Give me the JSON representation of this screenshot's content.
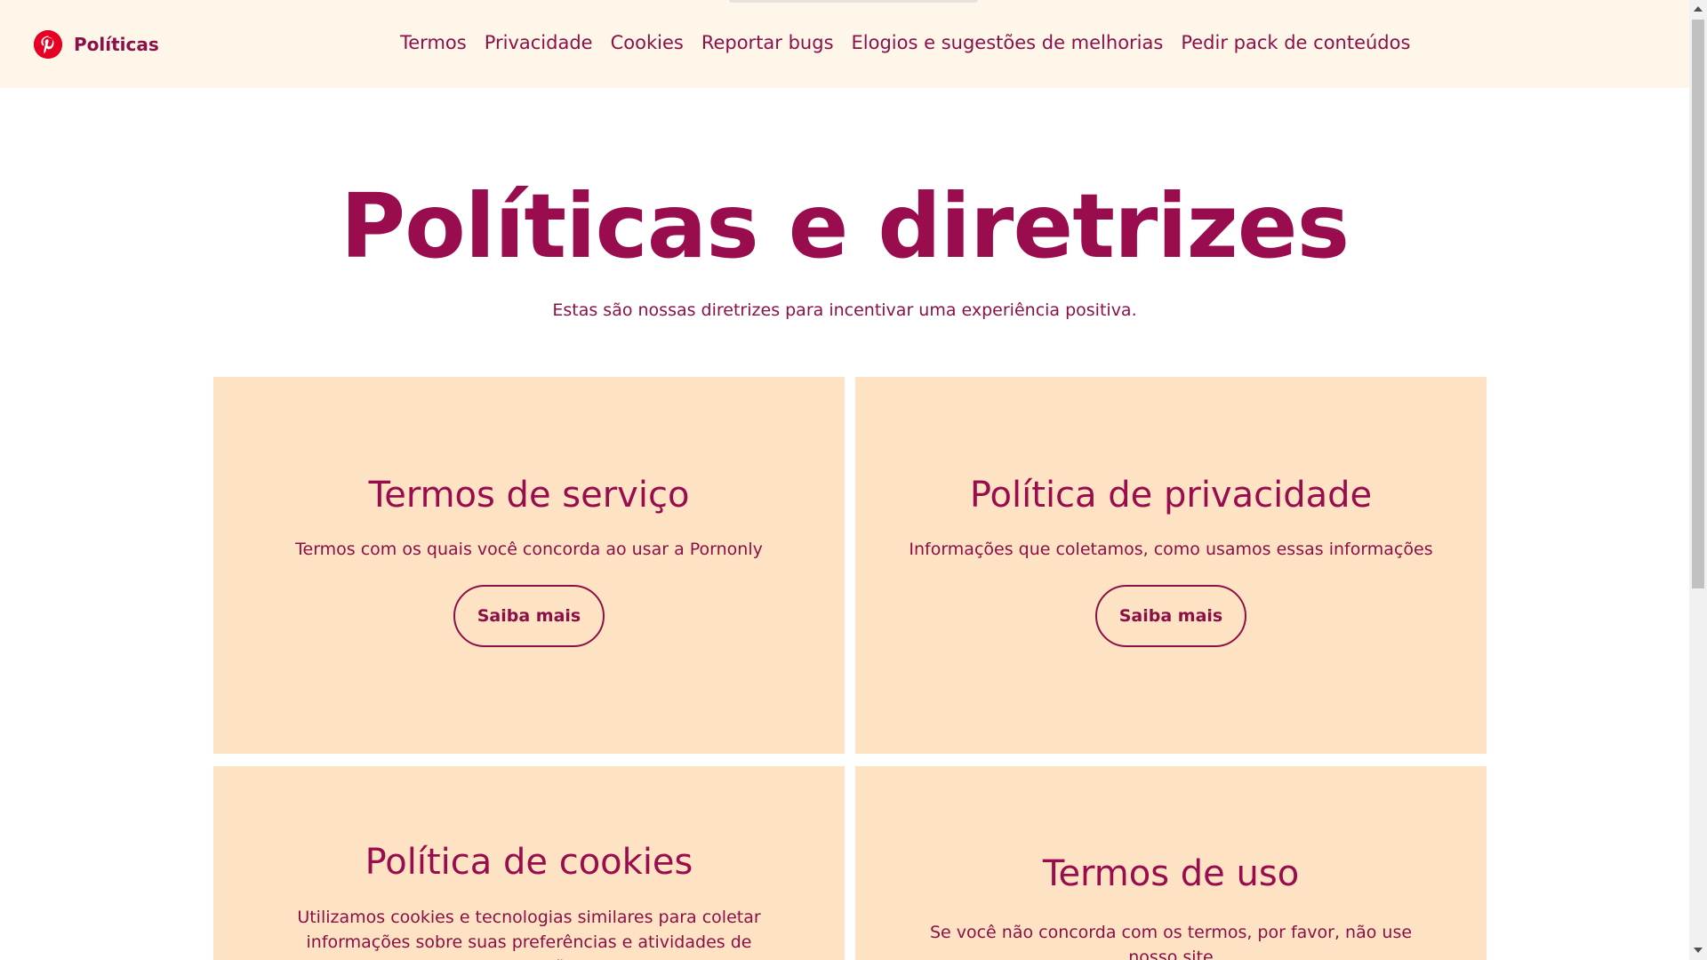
{
  "header": {
    "brand_name": "Políticas",
    "nav": [
      {
        "label": "Termos"
      },
      {
        "label": "Privacidade"
      },
      {
        "label": "Cookies"
      },
      {
        "label": "Reportar bugs"
      },
      {
        "label": "Elogios e sugestões de melhorias"
      },
      {
        "label": "Pedir pack de conteúdos"
      }
    ]
  },
  "hero": {
    "title": "Políticas e diretrizes",
    "subtitle": "Estas são nossas diretrizes para incentivar uma experiência positiva."
  },
  "cards": [
    {
      "title": "Termos de serviço",
      "description": "Termos com os quais você concorda ao usar a Pornonly",
      "button_label": "Saiba mais"
    },
    {
      "title": "Política de privacidade",
      "description": "Informações que coletamos, como usamos essas informações",
      "button_label": "Saiba mais"
    },
    {
      "title": "Política de cookies",
      "description": "Utilizamos cookies e tecnologias similares para coletar informações sobre suas preferências e atividades de navegação"
    },
    {
      "title": "Termos de uso",
      "description": "Se você não concorda com os termos, por favor, não use nosso site"
    }
  ],
  "colors": {
    "header_bg": "#fff6ea",
    "card_bg": "#fde3c3",
    "primary_text": "#8c1048",
    "logo_red": "#e60023"
  },
  "icons": {
    "brand_logo": "pinterest-logo-icon"
  }
}
